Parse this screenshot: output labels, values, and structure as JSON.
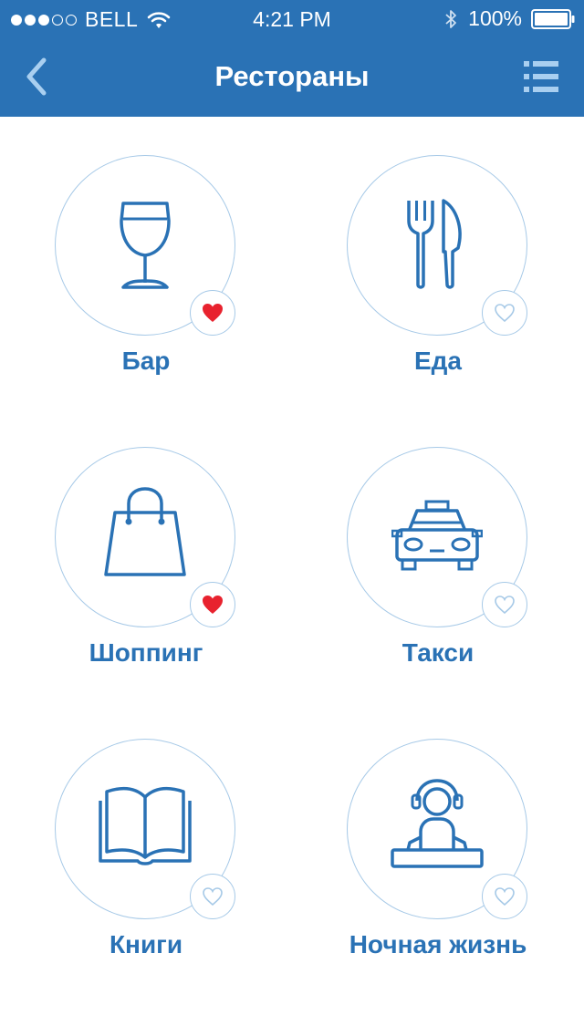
{
  "status_bar": {
    "carrier": "BELL",
    "time": "4:21 PM",
    "battery": "100%",
    "signal_bars_filled": 3,
    "signal_bars_total": 5
  },
  "nav": {
    "title": "Рестораны",
    "back_icon": "chevron-left-icon",
    "menu_icon": "list-icon"
  },
  "colors": {
    "primary": "#2a72b5",
    "heart_active": "#e8222e",
    "circle_border": "#a6c9e7"
  },
  "categories": [
    {
      "label": "Бар",
      "icon": "wine-glass-icon",
      "favorite": true
    },
    {
      "label": "Еда",
      "icon": "fork-knife-icon",
      "favorite": false
    },
    {
      "label": "Шоппинг",
      "icon": "shopping-bag-icon",
      "favorite": true
    },
    {
      "label": "Такси",
      "icon": "taxi-icon",
      "favorite": false
    },
    {
      "label": "Книги",
      "icon": "book-icon",
      "favorite": false
    },
    {
      "label": "Ночная жизнь",
      "icon": "dj-icon",
      "favorite": false
    }
  ]
}
